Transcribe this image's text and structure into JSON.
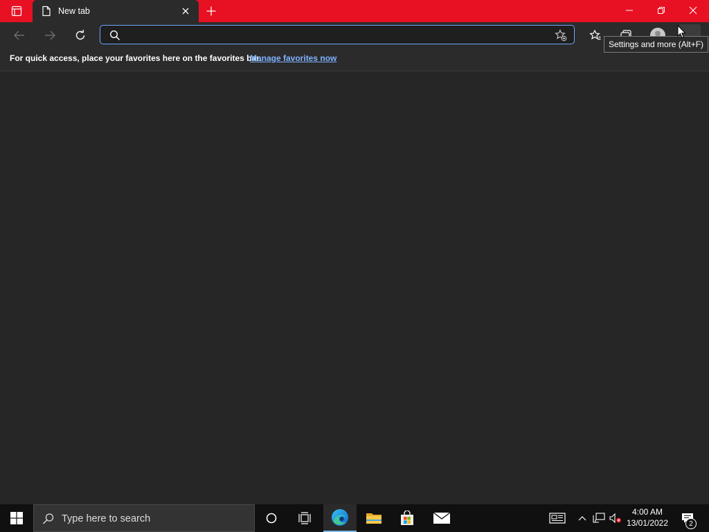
{
  "browser": {
    "tab": {
      "title": "New tab"
    },
    "address": {
      "value": "",
      "placeholder": ""
    },
    "favorites_bar": {
      "message": "For quick access, place your favorites here on the favorites bar.",
      "link": "Manage favorites now"
    },
    "tooltip": "Settings and more (Alt+F)"
  },
  "taskbar": {
    "search_placeholder": "Type here to search",
    "clock": {
      "time": "4:00 AM",
      "date": "13/01/2022"
    },
    "notification_count": "2"
  },
  "colors": {
    "titlebar": "#e81123",
    "chrome": "#2b2b2b",
    "page": "#262626",
    "link": "#7fb4ff",
    "taskbar": "#101010"
  }
}
